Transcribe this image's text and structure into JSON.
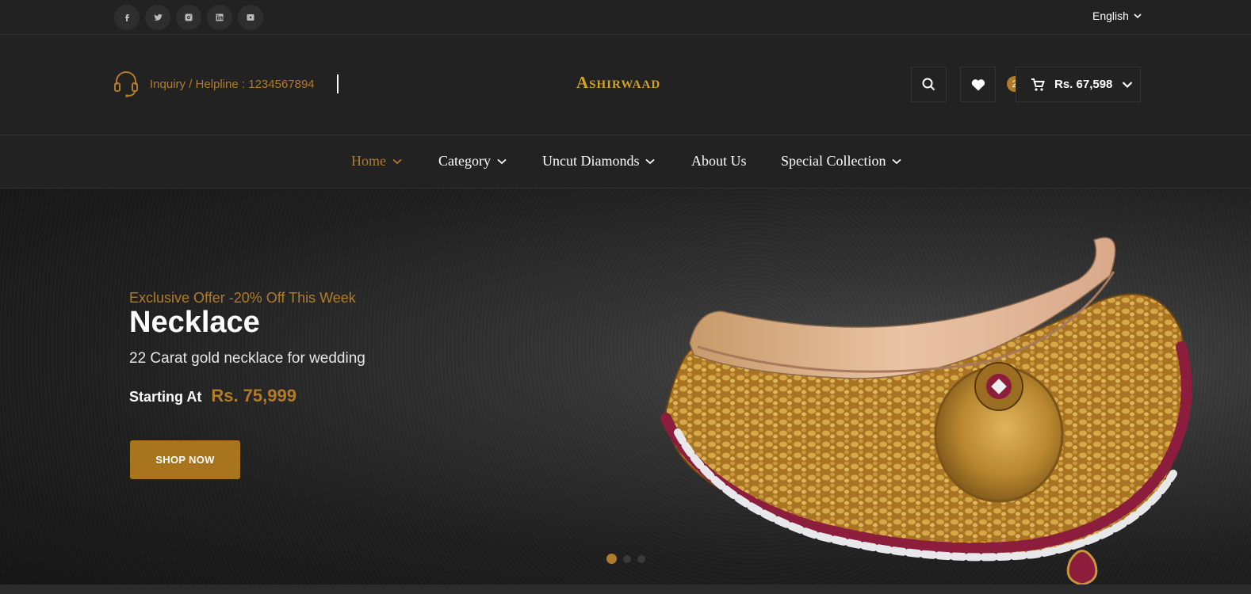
{
  "topbar": {
    "socials": [
      {
        "name": "facebook-icon",
        "glyph": "f"
      },
      {
        "name": "twitter-icon",
        "glyph": "t"
      },
      {
        "name": "instagram-icon",
        "glyph": "i"
      },
      {
        "name": "linkedin-icon",
        "glyph": "in"
      },
      {
        "name": "youtube-icon",
        "glyph": "yt"
      }
    ],
    "language": "English"
  },
  "header": {
    "helpline": "Inquiry / Helpline : 1234567894",
    "logo": "Ashirwaad",
    "cart_count": "2",
    "cart_amount": "Rs. 67,598"
  },
  "nav": {
    "items": [
      {
        "label": "Home",
        "dropdown": true,
        "active": true
      },
      {
        "label": "Category",
        "dropdown": true
      },
      {
        "label": "Uncut Diamonds",
        "dropdown": true
      },
      {
        "label": "About Us",
        "dropdown": false
      },
      {
        "label": "Special Collection",
        "dropdown": true
      }
    ]
  },
  "hero": {
    "offer": "Exclusive Offer -20% Off This Week",
    "title": "Necklace",
    "subtitle": "22 Carat gold necklace for wedding",
    "starting_label": "Starting At",
    "price": "Rs. 75,999",
    "button": "SHOP NOW",
    "slides": 3,
    "active_slide": 1
  },
  "colors": {
    "accent": "#b07c2a",
    "logo": "#d4a421",
    "background": "#222222"
  }
}
